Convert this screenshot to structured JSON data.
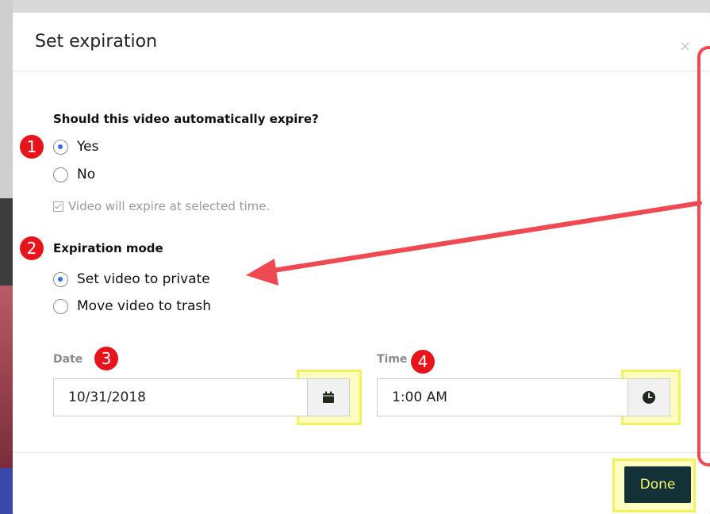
{
  "dialog": {
    "title": "Set expiration",
    "close_label": "×"
  },
  "expire_question": {
    "label": "Should this video automatically expire?",
    "options": [
      {
        "label": "Yes",
        "checked": true
      },
      {
        "label": "No",
        "checked": false
      }
    ],
    "note": "Video will expire at selected time."
  },
  "expiration_mode": {
    "label": "Expiration mode",
    "options": [
      {
        "label": "Set video to private",
        "checked": true
      },
      {
        "label": "Move video to trash",
        "checked": false
      }
    ]
  },
  "date_field": {
    "label": "Date",
    "value": "10/31/2018",
    "icon": "calendar-icon"
  },
  "time_field": {
    "label": "Time",
    "value": "1:00 AM",
    "icon": "clock-icon"
  },
  "footer": {
    "done_label": "Done"
  },
  "annotations": {
    "badges": [
      "1",
      "2",
      "3",
      "4"
    ]
  },
  "colors": {
    "accent_radio": "#2f6cf0",
    "done_bg": "#133238",
    "done_text": "#f3f36e",
    "badge": "#e8141c",
    "highlight": "#f2f25a",
    "arrow": "#ef4a52"
  }
}
